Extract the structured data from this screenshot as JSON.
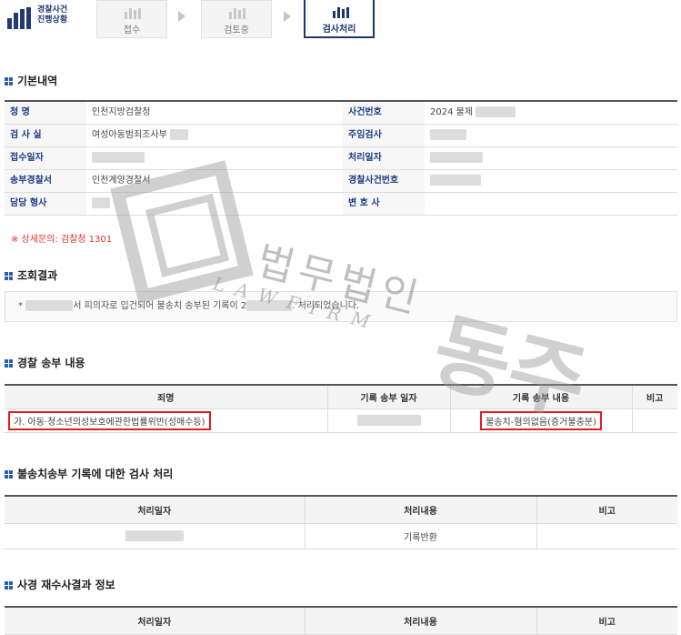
{
  "progress": {
    "title_line1": "경찰사건",
    "title_line2": "진행상황",
    "steps": [
      {
        "label": "접수",
        "active": false
      },
      {
        "label": "검토중",
        "active": false
      },
      {
        "label": "검사처리",
        "active": true
      }
    ]
  },
  "basic": {
    "title": "기본내역",
    "rows": [
      {
        "l1": "청    명",
        "v1": "인천지방검찰청",
        "l2": "사건번호",
        "v2": "2024 불제"
      },
      {
        "l1": "검 사 실",
        "v1": "여성아동범죄조사부",
        "l2": "주임검사",
        "v2": ""
      },
      {
        "l1": "접수일자",
        "v1": "",
        "l2": "처리일자",
        "v2": ""
      },
      {
        "l1": "송부경찰서",
        "v1": "인천계양경찰서",
        "l2": "경찰사건번호",
        "v2": ""
      },
      {
        "l1": "담당 형사",
        "v1": "",
        "l2": "변 호 사",
        "v2": ""
      }
    ],
    "contact": "※ 상세문의: 검찰청 1301"
  },
  "result": {
    "title": "조회결과",
    "text_a": "*",
    "text_b": "서 피의자로 입건되어 불송치 송부된 기록이 2",
    "text_c": ". 처리되었습니다."
  },
  "police": {
    "title": "경찰 송부 내용",
    "headers": [
      "죄명",
      "기록 송부 일자",
      "기록 송부 내용",
      "비고"
    ],
    "row": {
      "crime": "가. 아동·청소년의성보호에관한법률위반(성매수등)",
      "date": "",
      "content": "불송치-혐의없음(증거불충분)",
      "note": ""
    }
  },
  "disposal": {
    "title": "불송치송부 기록에 대한 검사 처리",
    "headers": [
      "처리일자",
      "처리내용",
      "비고"
    ],
    "row": {
      "date": "",
      "content": "기록반환",
      "note": ""
    }
  },
  "reinvest": {
    "title": "사경 재수사결과 정보",
    "headers": [
      "처리일자",
      "처리내용",
      "비고"
    ]
  },
  "watermark": {
    "line1": "법무법인",
    "line2": "LAWFIRM",
    "big": "동주"
  },
  "colors": {
    "navy": "#1c3769",
    "red_highlight": "#e41d1d",
    "label_blue": "#1c3c86"
  }
}
